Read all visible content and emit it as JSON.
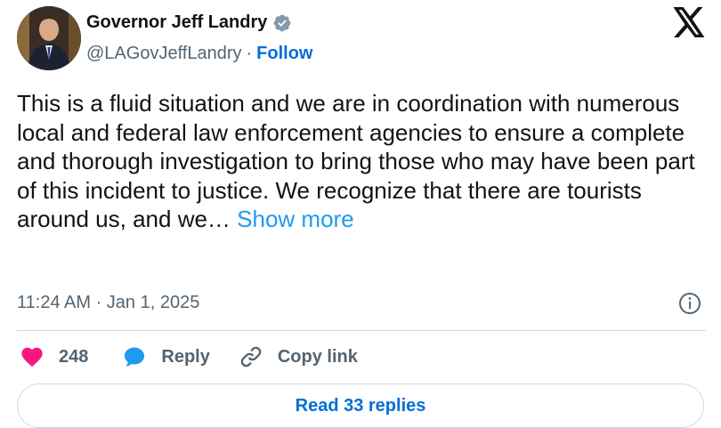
{
  "author": {
    "name": "Governor Jeff Landry",
    "handle": "@LAGovJeffLandry",
    "separator": "·",
    "follow_label": "Follow",
    "verified_icon": "verified-badge-icon"
  },
  "tweet": {
    "text": "This is a fluid situation and we are in coordination with numerous local and federal law enforcement agencies to ensure a complete and thorough investigation to bring those who may have been part of this incident to justice. We recognize that there are tourists around us, and we…",
    "show_more_label": "Show more",
    "timestamp": "11:24 AM · Jan 1, 2025"
  },
  "actions": {
    "like_count": "248",
    "reply_label": "Reply",
    "copy_link_label": "Copy link"
  },
  "footer": {
    "read_replies_label": "Read 33 replies"
  },
  "colors": {
    "link_blue": "#006fd6",
    "show_more_blue": "#1d9bf0",
    "heart_pink": "#f91880",
    "verified_gray": "#829aab",
    "muted_text": "#536471"
  }
}
